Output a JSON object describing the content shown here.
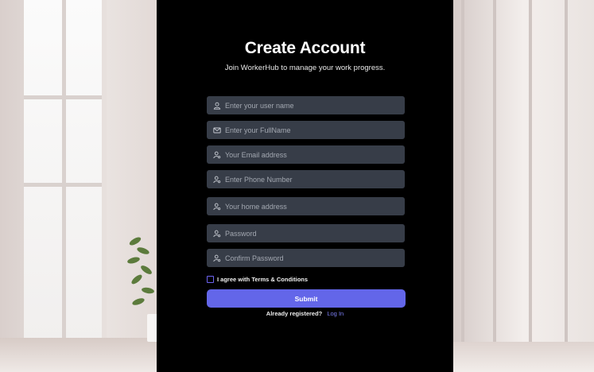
{
  "form": {
    "title": "Create Account",
    "subtitle": "Join WorkerHub to manage your work progress.",
    "fields": [
      {
        "name": "username",
        "placeholder": "Enter your user name",
        "icon": "user-icon"
      },
      {
        "name": "fullname",
        "placeholder": "Enter your FullName",
        "icon": "mail-icon"
      },
      {
        "name": "email",
        "placeholder": "Your Email address",
        "icon": "user-key-icon"
      },
      {
        "name": "phone",
        "placeholder": "Enter Phone Number",
        "icon": "user-key-icon"
      },
      {
        "name": "address",
        "placeholder": "Your home address",
        "icon": "user-key-icon"
      },
      {
        "name": "password",
        "placeholder": "Password",
        "icon": "user-key-icon"
      },
      {
        "name": "confirm_password",
        "placeholder": "Confirm Password",
        "icon": "user-key-icon"
      }
    ],
    "terms_label": "I agree with Terms & Conditions",
    "submit_label": "Submit",
    "already_text": "Already registered?",
    "login_label": "Log In"
  },
  "colors": {
    "panel_bg": "#000000",
    "field_bg": "#373d48",
    "accent": "#6366e9",
    "link": "#7c7ff5"
  }
}
